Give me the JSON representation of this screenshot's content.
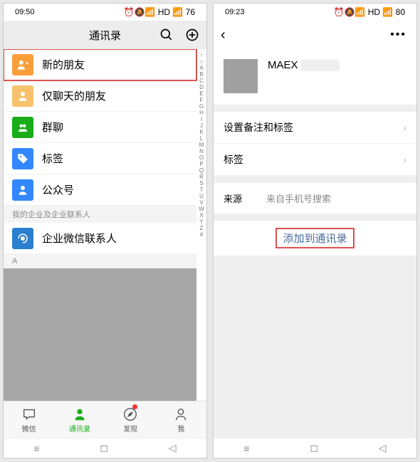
{
  "left": {
    "status_time": "09:50",
    "title": "通讯录",
    "rows": [
      {
        "label": "新的朋友"
      },
      {
        "label": "仅聊天的朋友"
      },
      {
        "label": "群聊"
      },
      {
        "label": "标签"
      },
      {
        "label": "公众号"
      }
    ],
    "section1": "我的企业及企业联系人",
    "corp_contact": "企业微信联系人",
    "section2": "A",
    "alpha": [
      "↑",
      "☆",
      "A",
      "B",
      "C",
      "D",
      "E",
      "F",
      "G",
      "H",
      "I",
      "J",
      "K",
      "L",
      "M",
      "N",
      "O",
      "P",
      "Q",
      "R",
      "S",
      "T",
      "U",
      "V",
      "W",
      "X",
      "Y",
      "Z",
      "#"
    ],
    "tabs": [
      {
        "label": "微信"
      },
      {
        "label": "通讯录"
      },
      {
        "label": "发现"
      },
      {
        "label": "我"
      }
    ]
  },
  "right": {
    "status_time": "09:23",
    "profile_name": "MAEX",
    "row_remark": "设置备注和标签",
    "row_tags": "标签",
    "source_k": "来源",
    "source_v": "来自手机号搜索",
    "add_btn": "添加到通讯录"
  }
}
